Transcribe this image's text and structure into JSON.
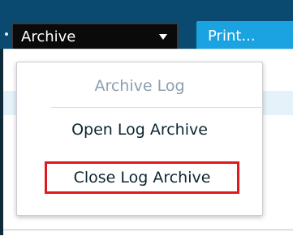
{
  "toolbar": {
    "archive_select_value": "Archive",
    "print_label": "Print..."
  },
  "menu": {
    "items": [
      {
        "label": "Archive Log",
        "enabled": false
      },
      {
        "label": "Open Log Archive",
        "enabled": true
      },
      {
        "label": "Close Log Archive",
        "enabled": true,
        "highlighted": true
      }
    ]
  },
  "colors": {
    "toolbar_bg": "#0b4a70",
    "select_bg": "#0a0a0a",
    "print_bg": "#1aa3e0",
    "highlight_border": "#e0191f",
    "disabled_text": "#8aa0b0"
  },
  "icons": {
    "archive_select": "chevron-down-icon"
  }
}
